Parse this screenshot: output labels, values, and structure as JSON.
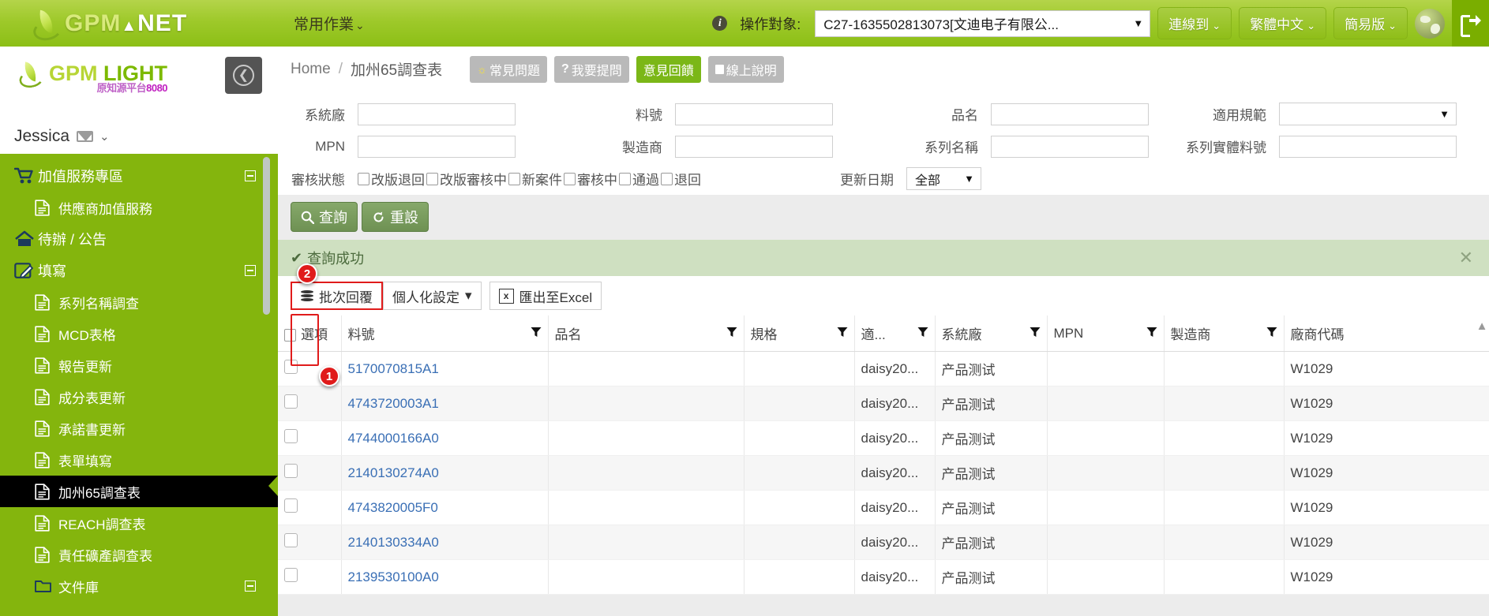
{
  "topbar": {
    "brand_gpm": "GPM",
    "brand_tri": "▲",
    "brand_net": "NET",
    "menu_label": "常用作業",
    "menu_caret": "⌄",
    "info_icon": "i",
    "operate_label": "操作對象:",
    "operate_value": "C27-1635502813073[文迪电子有限公...",
    "connect_label": "連線到",
    "lang_label": "繁體中文",
    "simple_label": "簡易版",
    "globe_icon": "globe-icon",
    "logout_icon": "logout-icon"
  },
  "sidebar": {
    "logo_g": "GPM",
    "logo_light": "LIGHT",
    "logo_sub": "原知源平台",
    "logo_sub_num": "8080",
    "collapse_icon": "←",
    "user_name": "Jessica",
    "mail_icon": "mail-icon",
    "user_caret": "⌄",
    "items": [
      {
        "label": "加值服務專區",
        "icon": "cart-icon",
        "level": 0,
        "toggle": true,
        "active": false
      },
      {
        "label": "供應商加值服務",
        "icon": "doc-icon",
        "level": 1,
        "toggle": false,
        "active": false
      },
      {
        "label": "待辦 / 公告",
        "icon": "home-icon",
        "level": 0,
        "toggle": false,
        "active": false
      },
      {
        "label": "填寫",
        "icon": "pencil-icon",
        "level": 0,
        "toggle": true,
        "active": false
      },
      {
        "label": "系列名稱調查",
        "icon": "doc-icon",
        "level": 1,
        "toggle": false,
        "active": false
      },
      {
        "label": "MCD表格",
        "icon": "doc-icon",
        "level": 1,
        "toggle": false,
        "active": false
      },
      {
        "label": "報告更新",
        "icon": "doc-icon",
        "level": 1,
        "toggle": false,
        "active": false
      },
      {
        "label": "成分表更新",
        "icon": "doc-icon",
        "level": 1,
        "toggle": false,
        "active": false
      },
      {
        "label": "承諾書更新",
        "icon": "doc-icon",
        "level": 1,
        "toggle": false,
        "active": false
      },
      {
        "label": "表單填寫",
        "icon": "doc-icon",
        "level": 1,
        "toggle": false,
        "active": false
      },
      {
        "label": "加州65調查表",
        "icon": "doc-icon",
        "level": 1,
        "toggle": false,
        "active": true
      },
      {
        "label": "REACH調查表",
        "icon": "doc-icon",
        "level": 1,
        "toggle": false,
        "active": false
      },
      {
        "label": "責任礦產調查表",
        "icon": "doc-icon",
        "level": 1,
        "toggle": false,
        "active": false
      },
      {
        "label": "文件庫",
        "icon": "folder-icon",
        "level": 1,
        "toggle": true,
        "active": false
      }
    ]
  },
  "breadcrumb": {
    "home": "Home",
    "sep": "/",
    "current": "加州65調查表"
  },
  "help_buttons": [
    {
      "label": "常見問題",
      "icon": "bulb-icon",
      "style": "gray"
    },
    {
      "label": "我要提問",
      "icon": "question-icon",
      "style": "gray"
    },
    {
      "label": "意見回饋",
      "icon": "none",
      "style": "green"
    },
    {
      "label": "線上說明",
      "icon": "book-icon",
      "style": "gray"
    }
  ],
  "search_form": {
    "row1": [
      {
        "label": "系統廠",
        "value": "",
        "type": "text"
      },
      {
        "label": "料號",
        "value": "",
        "type": "text"
      },
      {
        "label": "品名",
        "value": "",
        "type": "text"
      },
      {
        "label": "適用規範",
        "value": "",
        "type": "select"
      }
    ],
    "row2": [
      {
        "label": "MPN",
        "value": "",
        "type": "text"
      },
      {
        "label": "製造商",
        "value": "",
        "type": "text"
      },
      {
        "label": "系列名稱",
        "value": "",
        "type": "text"
      },
      {
        "label": "系列實體料號",
        "value": "",
        "type": "text"
      }
    ],
    "status_label": "審核狀態",
    "status_options": [
      "改版退回",
      "改版審核中",
      "新案件",
      "審核中",
      "通過",
      "退回"
    ],
    "date_label": "更新日期",
    "date_value": "全部",
    "search_button": "查詢",
    "reset_button": "重設",
    "search_icon": "search-icon",
    "reset_icon": "reset-icon"
  },
  "alert": {
    "icon": "check-icon",
    "message": "查詢成功",
    "close": "✕"
  },
  "toolbar": {
    "batch_reply": "批次回覆",
    "batch_icon": "stack-icon",
    "personalize": "個人化設定",
    "personalize_caret": "▾",
    "export_excel": "匯出至Excel",
    "excel_icon": "excel-icon"
  },
  "badges": [
    {
      "number": "1"
    },
    {
      "number": "2"
    }
  ],
  "table": {
    "select_header": "選項",
    "columns": [
      "料號",
      "品名",
      "規格",
      "適...",
      "系統廠",
      "MPN",
      "製造商",
      "廠商代碼"
    ],
    "rows": [
      {
        "part_no": "5170070815A1",
        "name": "",
        "spec": "",
        "scope": "daisy20...",
        "system": "产品测试",
        "mpn": "",
        "maker": "",
        "vendor": "W1029"
      },
      {
        "part_no": "4743720003A1",
        "name": "",
        "spec": "",
        "scope": "daisy20...",
        "system": "产品测试",
        "mpn": "",
        "maker": "",
        "vendor": "W1029"
      },
      {
        "part_no": "4744000166A0",
        "name": "",
        "spec": "",
        "scope": "daisy20...",
        "system": "产品测试",
        "mpn": "",
        "maker": "",
        "vendor": "W1029"
      },
      {
        "part_no": "2140130274A0",
        "name": "",
        "spec": "",
        "scope": "daisy20...",
        "system": "产品测试",
        "mpn": "",
        "maker": "",
        "vendor": "W1029"
      },
      {
        "part_no": "4743820005F0",
        "name": "",
        "spec": "",
        "scope": "daisy20...",
        "system": "产品测试",
        "mpn": "",
        "maker": "",
        "vendor": "W1029"
      },
      {
        "part_no": "2140130334A0",
        "name": "",
        "spec": "",
        "scope": "daisy20...",
        "system": "产品测试",
        "mpn": "",
        "maker": "",
        "vendor": "W1029"
      },
      {
        "part_no": "2139530100A0",
        "name": "",
        "spec": "",
        "scope": "daisy20...",
        "system": "产品测试",
        "mpn": "",
        "maker": "",
        "vendor": "W1029"
      }
    ],
    "scroll_up_icon": "▲"
  },
  "colors": {
    "brand_green": "#8cbf16",
    "sidebar_green": "#84b50d",
    "accent_red": "#e01b1b",
    "link_blue": "#3a6fb5",
    "alert_bg": "#cfe0c1"
  }
}
